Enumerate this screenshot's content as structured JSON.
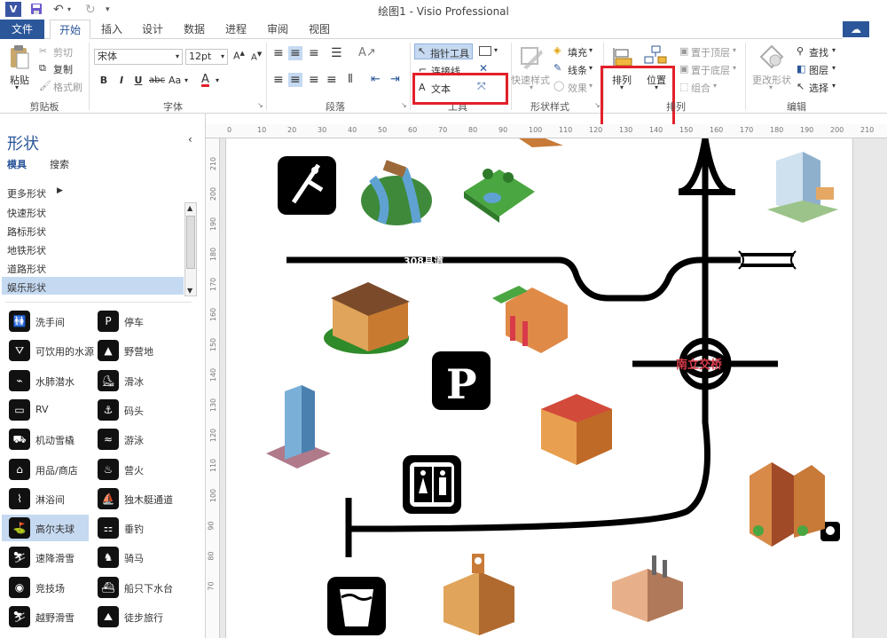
{
  "window": {
    "title": "绘图1 - Visio Professional",
    "app_icon": "V"
  },
  "tabs": [
    "文件",
    "开始",
    "插入",
    "设计",
    "数据",
    "进程",
    "审阅",
    "视图"
  ],
  "ribbon": {
    "clipboard": {
      "paste": "粘贴",
      "cut": "剪切",
      "copy": "复制",
      "format_painter": "格式刷",
      "label": "剪贴板"
    },
    "font": {
      "name": "宋体",
      "size": "12pt",
      "bold": "B",
      "italic": "I",
      "underline": "U",
      "strike": "abc",
      "case": "Aa",
      "label": "字体"
    },
    "paragraph": {
      "label": "段落"
    },
    "tools": {
      "pointer": "指针工具",
      "connector": "连接线",
      "text": "文本",
      "label": "工具"
    },
    "shape_styles": {
      "quick_styles": "快速样式",
      "fill": "填充",
      "line": "线条",
      "effects": "效果",
      "label": "形状样式"
    },
    "arrange": {
      "arrange": "排列",
      "position": "位置",
      "bring_front": "置于顶层",
      "send_back": "置于底层",
      "group": "组合",
      "label": "排列"
    },
    "editing": {
      "change_shape": "更改形状",
      "find": "查找",
      "layers": "图层",
      "select": "选择",
      "label": "编辑"
    }
  },
  "shapes_panel": {
    "title": "形状",
    "tab_stencils": "模具",
    "tab_search": "搜索",
    "more_shapes": "更多形状",
    "stencils": [
      "快速形状",
      "路标形状",
      "地铁形状",
      "道路形状",
      "娱乐形状"
    ],
    "selected_stencil": "娱乐形状",
    "items": [
      [
        "洗手间",
        "停车"
      ],
      [
        "可饮用的水源",
        "野营地"
      ],
      [
        "水肺潜水",
        "滑冰"
      ],
      [
        "RV",
        "码头"
      ],
      [
        "机动雪橇",
        "游泳"
      ],
      [
        "用品/商店",
        "营火"
      ],
      [
        "淋浴间",
        "独木艇通道"
      ],
      [
        "高尔夫球",
        "垂钓"
      ],
      [
        "速降滑雪",
        "骑马"
      ],
      [
        "竞技场",
        "船只下水台"
      ],
      [
        "越野滑雪",
        "徒步旅行"
      ]
    ],
    "selected_item": "高尔夫球"
  },
  "ruler": {
    "top": [
      "0",
      "10",
      "20",
      "30",
      "40",
      "50",
      "60",
      "70",
      "80",
      "90",
      "100",
      "110",
      "120",
      "130",
      "140",
      "150",
      "160",
      "170",
      "180",
      "190",
      "200",
      "210"
    ],
    "left": [
      "210",
      "200",
      "190",
      "180",
      "170",
      "160",
      "150",
      "140",
      "130",
      "120",
      "110",
      "100",
      "90",
      "80",
      "70"
    ]
  },
  "canvas": {
    "road_label_1": "308县道",
    "road_label_2": "南立交桥"
  },
  "colors": {
    "accent": "#2b579a",
    "highlight": "#e3202a",
    "selected": "#c5d9f1"
  }
}
